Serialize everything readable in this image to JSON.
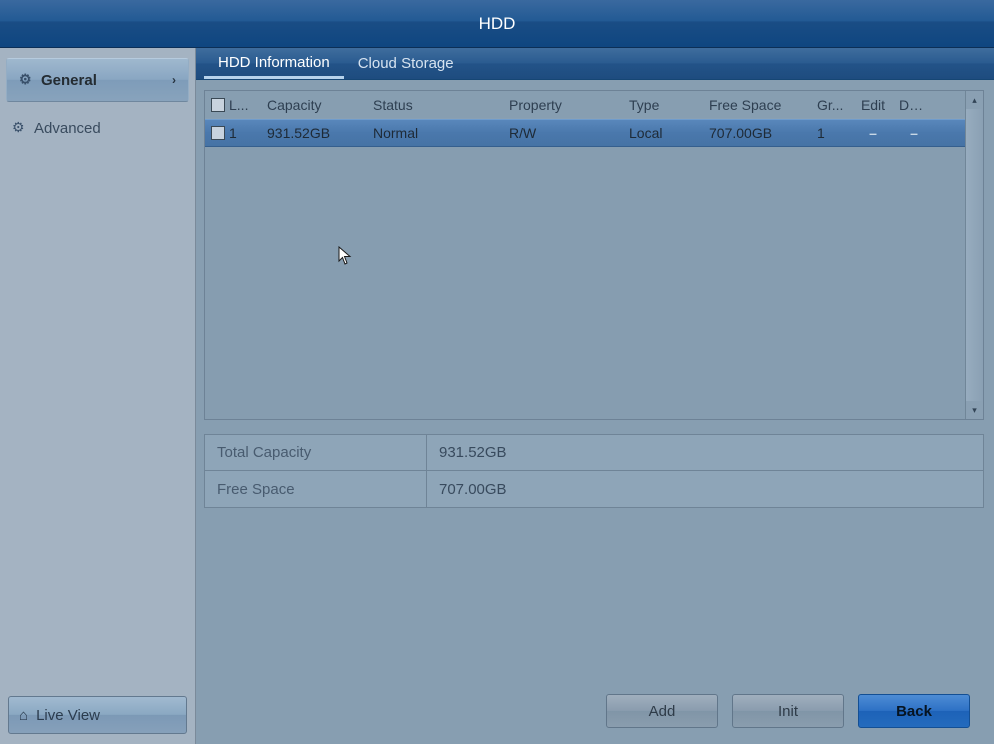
{
  "title": "HDD",
  "sidebar": {
    "items": [
      {
        "label": "General",
        "active": true
      },
      {
        "label": "Advanced",
        "active": false
      }
    ],
    "live_view": "Live View"
  },
  "tabs": [
    {
      "label": "HDD Information",
      "active": true
    },
    {
      "label": "Cloud Storage",
      "active": false
    }
  ],
  "table": {
    "headers": {
      "check": "L...",
      "capacity": "Capacity",
      "status": "Status",
      "property": "Property",
      "type": "Type",
      "free": "Free Space",
      "group": "Gr...",
      "edit": "Edit",
      "del": "Del..."
    },
    "rows": [
      {
        "num": "1",
        "capacity": "931.52GB",
        "status": "Normal",
        "property": "R/W",
        "type": "Local",
        "free": "707.00GB",
        "group": "1",
        "edit": "–",
        "del": "–"
      }
    ]
  },
  "summary": {
    "total_capacity": {
      "label": "Total Capacity",
      "value": "931.52GB"
    },
    "free_space": {
      "label": "Free Space",
      "value": "707.00GB"
    }
  },
  "buttons": {
    "add": "Add",
    "init": "Init",
    "back": "Back"
  }
}
